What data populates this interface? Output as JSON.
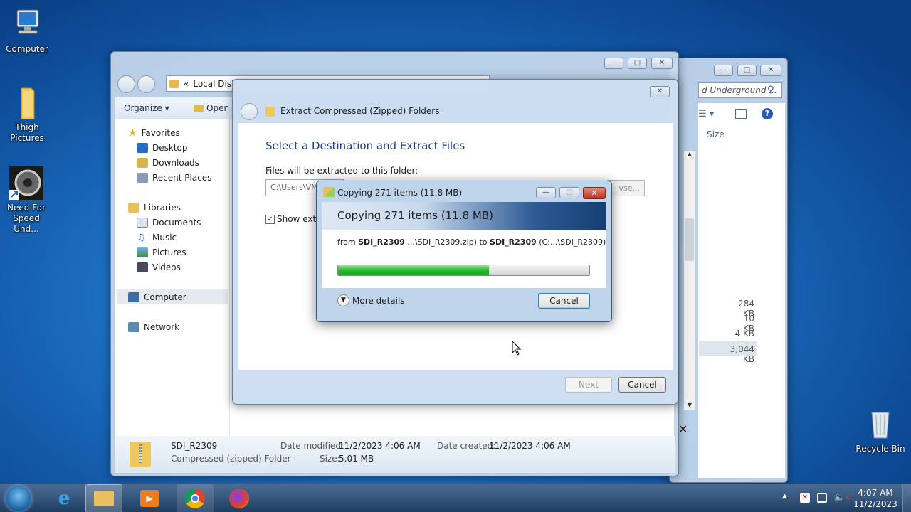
{
  "desktop": {
    "icons": [
      {
        "label": "Computer"
      },
      {
        "label": "Thigh Pictures"
      },
      {
        "label": "Need For Speed Und..."
      },
      {
        "label": "Recycle Bin"
      }
    ]
  },
  "back_window": {
    "search_placeholder": "d Underground ...",
    "column_size": "Size",
    "sizes": [
      "284 KB",
      "10 KB",
      "4 KB",
      "3,044 KB"
    ]
  },
  "explorer": {
    "address": "Local Disk",
    "address_chevron": "«",
    "toolbar": {
      "organize": "Organize",
      "open": "Open"
    },
    "nav": {
      "favorites": "Favorites",
      "favorites_items": [
        "Desktop",
        "Downloads",
        "Recent Places"
      ],
      "libraries": "Libraries",
      "libraries_items": [
        "Documents",
        "Music",
        "Pictures",
        "Videos"
      ],
      "computer": "Computer",
      "network": "Network"
    },
    "details": {
      "name": "SDI_R2309",
      "type": "Compressed (zipped) Folder",
      "modified_label": "Date modified:",
      "modified_value": "11/2/2023 4:06 AM",
      "created_label": "Date created:",
      "created_value": "11/2/2023 4:06 AM",
      "size_label": "Size:",
      "size_value": "5.01 MB"
    }
  },
  "extract": {
    "title": "Extract Compressed (Zipped) Folders",
    "heading": "Select a Destination and Extract Files",
    "folder_label": "Files will be extracted to this folder:",
    "folder_value": "C:\\Users\\VM",
    "browse_label": "vse...",
    "show_label": "Show extra",
    "show_checked": true,
    "next_label": "Next",
    "cancel_label": "Cancel"
  },
  "copy": {
    "title": "Copying 271 items (11.8 MB)",
    "header": "Copying 271 items (11.8 MB)",
    "from_word": "from",
    "src_name": "SDI_R2309",
    "src_path": "...\\SDI_R2309.zip)",
    "to_word": "to",
    "dst_name": "SDI_R2309",
    "dst_path": "(C:...\\SDI_R2309)",
    "progress": 0.6,
    "more_details": "More details",
    "cancel_label": "Cancel"
  },
  "taskbar": {
    "time": "4:07 AM",
    "date": "11/2/2023",
    "apps": [
      "internet-explorer",
      "windows-explorer",
      "media-player",
      "chrome",
      "firefox"
    ]
  },
  "colors": {
    "progress": "#33c23a",
    "heading": "#1e3f8a",
    "taskbar": "#1b3a5f"
  }
}
